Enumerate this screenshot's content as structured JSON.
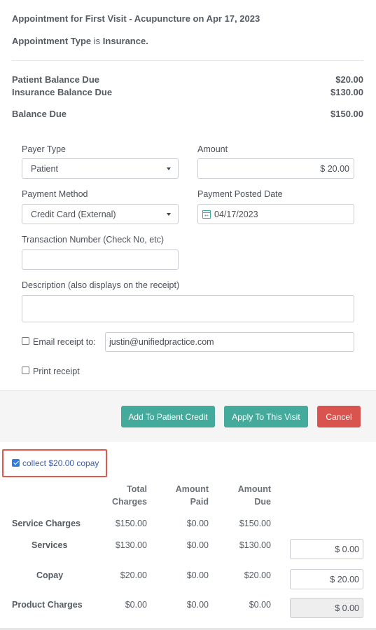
{
  "header": {
    "title": "Appointment for First Visit - Acupuncture on Apr 17, 2023",
    "type_label": "Appointment Type",
    "type_connector": "is",
    "type_value": "Insurance."
  },
  "balances": {
    "patient_label": "Patient Balance Due",
    "patient_value": "$20.00",
    "insurance_label": "Insurance Balance Due",
    "insurance_value": "$130.00",
    "total_label": "Balance Due",
    "total_value": "$150.00"
  },
  "form": {
    "payer_type_label": "Payer Type",
    "payer_type_value": "Patient",
    "amount_label": "Amount",
    "amount_value": "$ 20.00",
    "payment_method_label": "Payment Method",
    "payment_method_value": "Credit Card (External)",
    "posted_date_label": "Payment Posted Date",
    "posted_date_value": "04/17/2023",
    "transaction_label": "Transaction Number (Check No, etc)",
    "transaction_value": "",
    "description_label": "Description (also displays on the receipt)",
    "description_value": "",
    "email_label": "Email receipt to:",
    "email_checked": false,
    "email_value": "justin@unifiedpractice.com",
    "print_label": "Print receipt",
    "print_checked": false
  },
  "buttons": {
    "add_credit": "Add To Patient Credit",
    "apply_visit": "Apply To This Visit",
    "cancel": "Cancel"
  },
  "copay": {
    "label": "collect $20.00 copay",
    "checked": true
  },
  "charges_table": {
    "headers": {
      "total_1": "Total",
      "total_2": "Charges",
      "paid_1": "Amount",
      "paid_2": "Paid",
      "due_1": "Amount",
      "due_2": "Due"
    },
    "rows": [
      {
        "label": "Service Charges",
        "total": "$150.00",
        "paid": "$0.00",
        "due": "$150.00",
        "input": null
      },
      {
        "label": "Services",
        "total": "$130.00",
        "paid": "$0.00",
        "due": "$130.00",
        "input": "$ 0.00"
      },
      {
        "label": "Copay",
        "total": "$20.00",
        "paid": "$0.00",
        "due": "$20.00",
        "input": "$ 20.00"
      },
      {
        "label": "Product Charges",
        "total": "$0.00",
        "paid": "$0.00",
        "due": "$0.00",
        "input": "$ 0.00"
      }
    ]
  },
  "colors": {
    "teal_button": "#44aa9c",
    "cancel_button": "#d9534f",
    "highlight_border": "#e0584c",
    "checkbox_checked": "#2f7de1"
  }
}
